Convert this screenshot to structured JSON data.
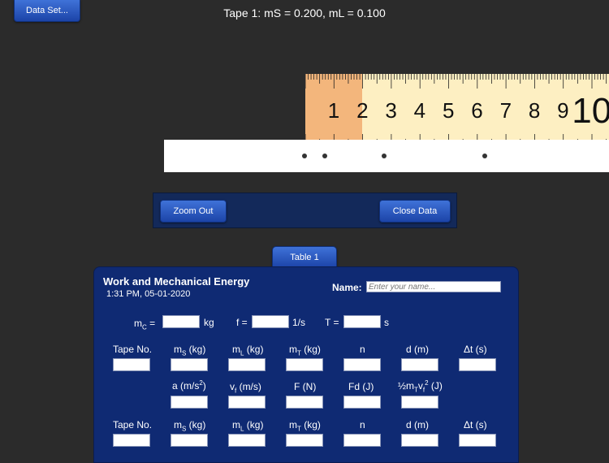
{
  "toolbar": {
    "dataset_label": "Data Set..."
  },
  "tape_title": "Tape 1: mS = 0.200, mL = 0.100",
  "ruler": {
    "numbers": [
      "1",
      "2",
      "3",
      "4",
      "5",
      "6",
      "7",
      "8",
      "9",
      "10"
    ]
  },
  "zoom_panel": {
    "zoom_out_label": "Zoom Out",
    "close_data_label": "Close Data"
  },
  "tabs": [
    {
      "label": "Table 1"
    }
  ],
  "table": {
    "title": "Work and Mechanical Energy",
    "timestamp": "1:31 PM, 05-01-2020",
    "name_label": "Name:",
    "name_placeholder": "Enter your name...",
    "constants": {
      "mc_label": "m",
      "mc_sub": "C",
      "mc_eq": "=",
      "mc_unit": "kg",
      "f_label": "f =",
      "f_unit": "1/s",
      "T_label": "T =",
      "T_unit": "s"
    },
    "headers_row1": {
      "tape_no": "Tape No.",
      "ms": "m",
      "ms_sub": "S",
      "ms_unit": " (kg)",
      "ml": "m",
      "ml_sub": "L",
      "ml_unit": " (kg)",
      "mt": "m",
      "mt_sub": "T",
      "mt_unit": " (kg)",
      "n": "n",
      "d": "d (m)",
      "dt": "Δt (s)"
    },
    "headers_row2": {
      "a": "a (m/s",
      "a_sup": "2",
      "a_end": ")",
      "vf": "v",
      "vf_sub": "f",
      "vf_unit": " (m/s)",
      "F": "F (N)",
      "Fd": "Fd (J)",
      "ke_a": "½m",
      "ke_sub1": "T",
      "ke_b": "v",
      "ke_sub2": "f",
      "ke_sup": "2",
      "ke_unit": " (J)"
    }
  }
}
